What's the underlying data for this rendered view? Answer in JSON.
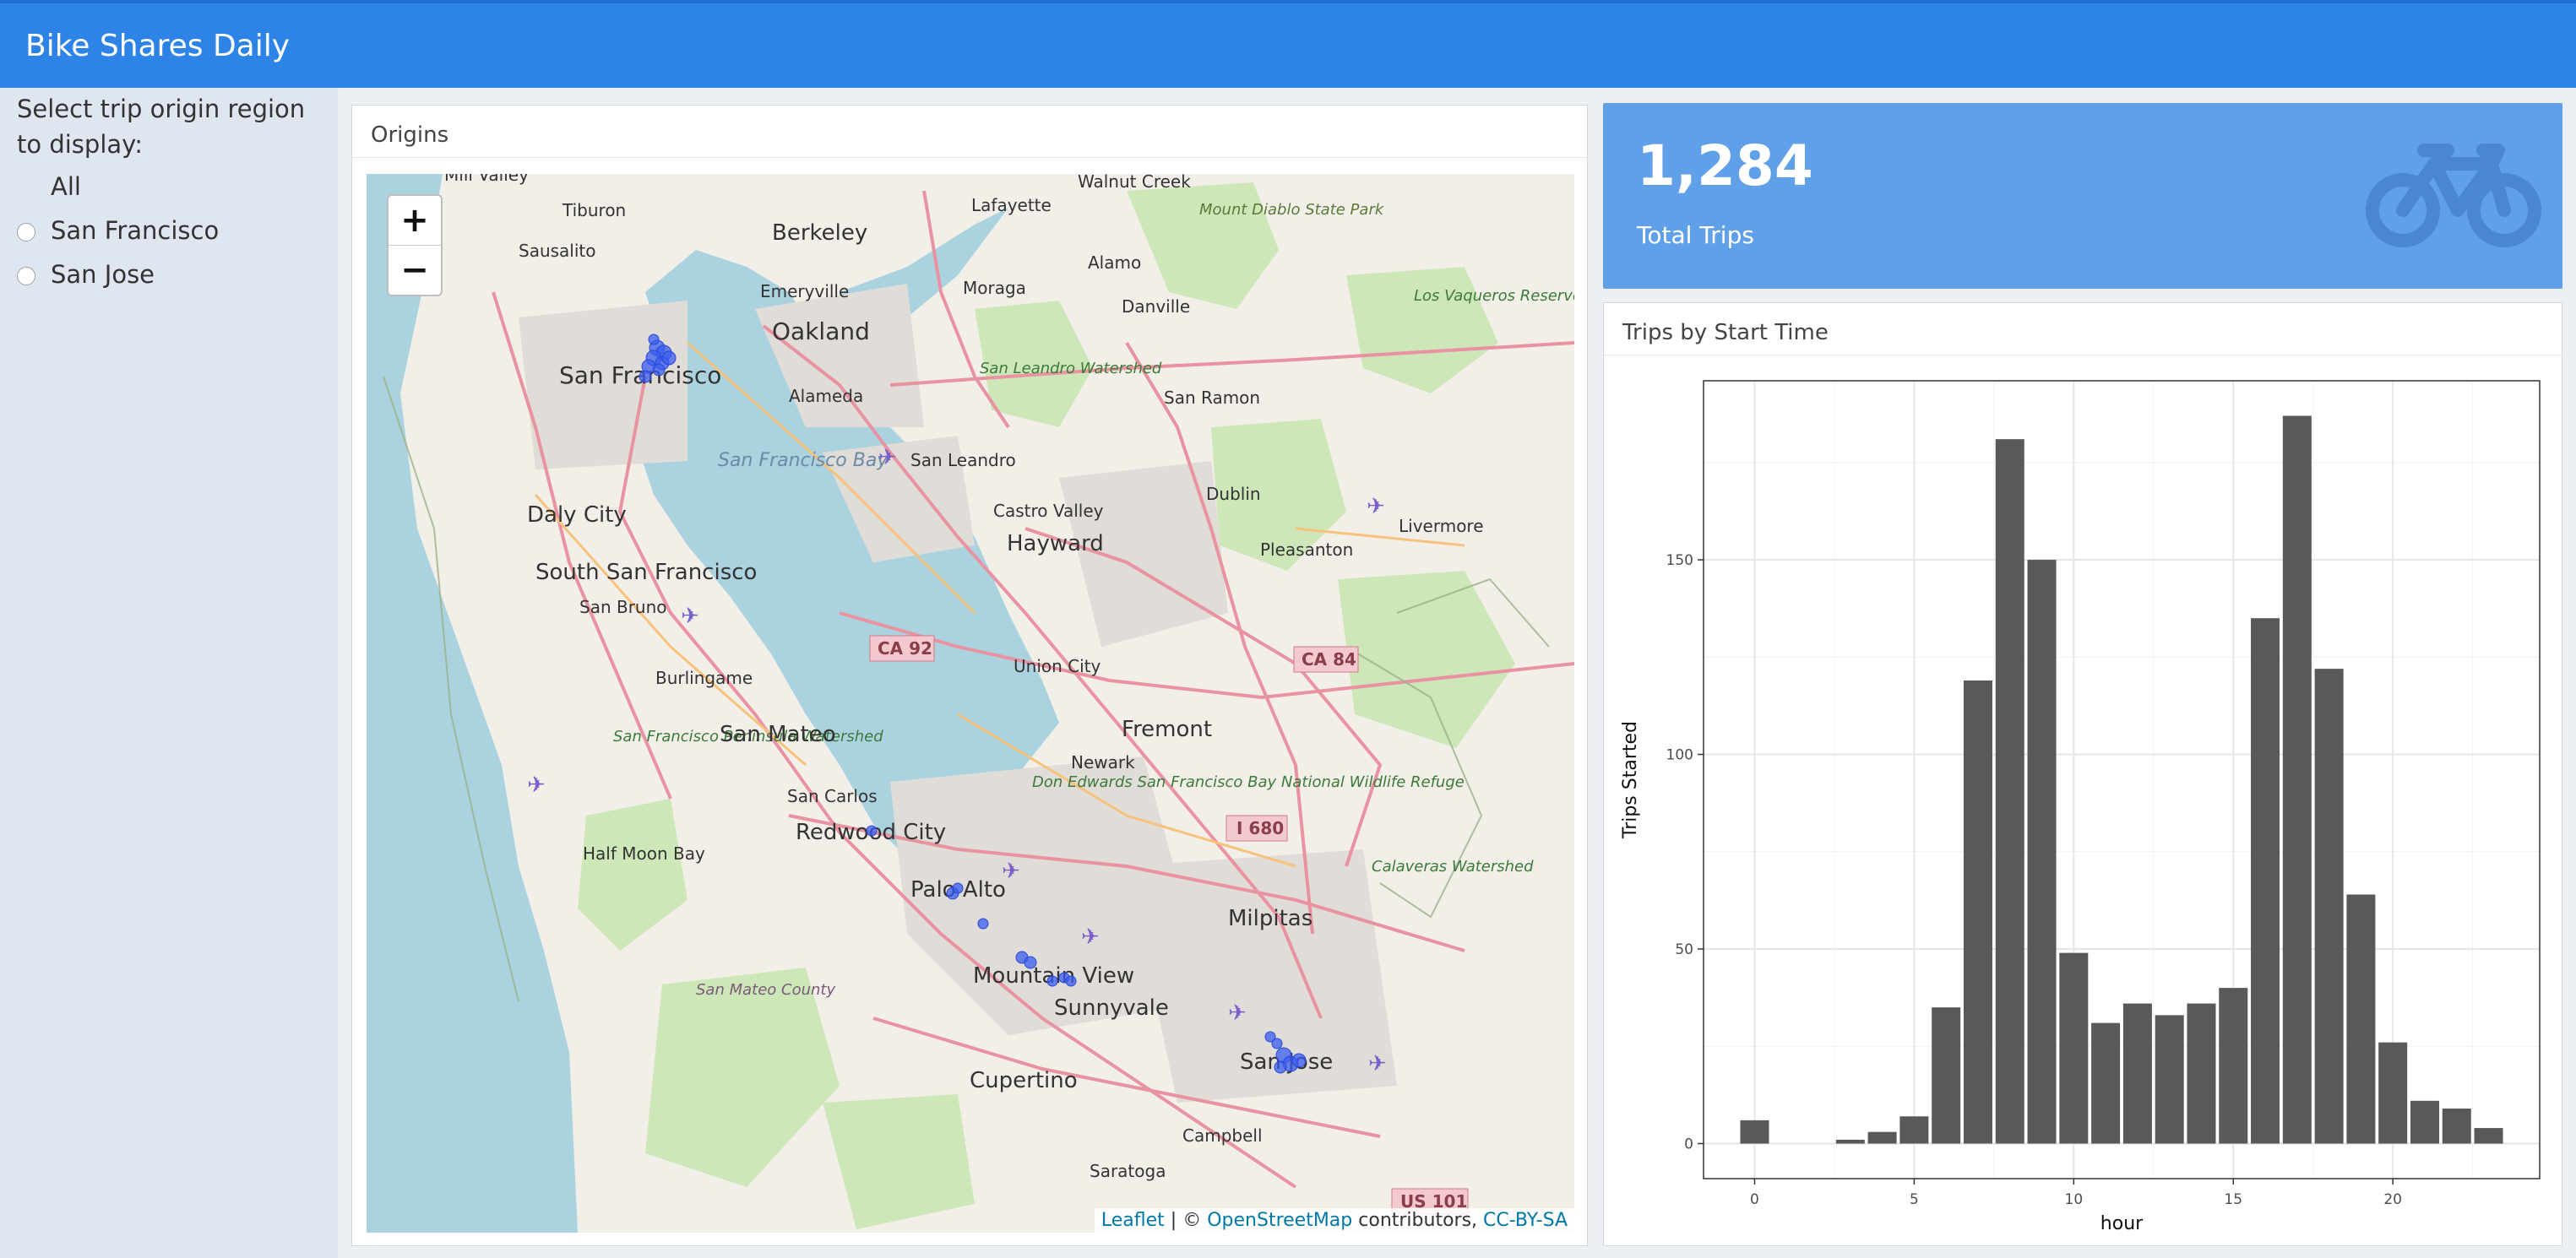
{
  "app": {
    "title": "Bike Shares Daily"
  },
  "sidebar": {
    "prompt": "Select trip origin region to display:",
    "options": [
      {
        "label": "All",
        "selected": true
      },
      {
        "label": "San Francisco",
        "selected": false
      },
      {
        "label": "San Jose",
        "selected": false
      }
    ]
  },
  "origins_panel": {
    "title": "Origins",
    "zoom_in": "+",
    "zoom_out": "−",
    "attribution": {
      "leaflet": "Leaflet",
      "sep": " | © ",
      "osm": "OpenStreetMap",
      "contrib": " contributors, ",
      "license": "CC-BY-SA"
    },
    "places": [
      "Mill Valley",
      "Tiburon",
      "Sausalito",
      "San Francisco",
      "Berkeley",
      "Oakland",
      "Emeryville",
      "Alameda",
      "Lafayette",
      "Walnut Creek",
      "Moraga",
      "Alamo",
      "Danville",
      "Mount Diablo State Park",
      "Los Vaqueros Reservoir and Watershed",
      "San Leandro Watershed",
      "San Leandro",
      "San Ramon",
      "San Francisco Bay",
      "Daly City",
      "South San Francisco",
      "San Bruno",
      "Burlingame",
      "Castro Valley",
      "Hayward",
      "Dublin",
      "Pleasanton",
      "Livermore",
      "Union City",
      "Fremont",
      "San Francisco Peninsula Watershed",
      "San Mateo",
      "Newark",
      "Don Edwards San Francisco Bay National Wildlife Refuge",
      "San Carlos",
      "Redwood City",
      "Half Moon Bay",
      "Palo Alto",
      "Milpitas",
      "Calaveras Watershed",
      "Mountain View",
      "Sunnyvale",
      "San Mateo County",
      "Cupertino",
      "San Jose",
      "Campbell",
      "Saratoga"
    ],
    "road_shields": [
      "CA 92",
      "CA 84",
      "I 680",
      "US 101"
    ]
  },
  "total_trips": {
    "value": "1,284",
    "caption": "Total Trips",
    "icon": "bicycle-icon"
  },
  "chart_panel": {
    "title": "Trips by Start Time"
  },
  "chart_data": {
    "type": "bar",
    "xlabel": "hour",
    "ylabel": "Trips Started",
    "x": [
      0,
      1,
      2,
      3,
      4,
      5,
      6,
      7,
      8,
      9,
      10,
      11,
      12,
      13,
      14,
      15,
      16,
      17,
      18,
      19,
      20,
      21,
      22,
      23
    ],
    "values": [
      6,
      0,
      0,
      1,
      3,
      7,
      35,
      119,
      181,
      150,
      49,
      31,
      36,
      33,
      36,
      40,
      135,
      187,
      122,
      64,
      26,
      11,
      9,
      4
    ],
    "xlim": [
      -1.6,
      24.6
    ],
    "ylim": [
      -9,
      196
    ],
    "xticks": [
      0,
      5,
      10,
      15,
      20
    ],
    "yticks": [
      0,
      50,
      100,
      150
    ],
    "bar_color": "#595959",
    "grid": true
  }
}
